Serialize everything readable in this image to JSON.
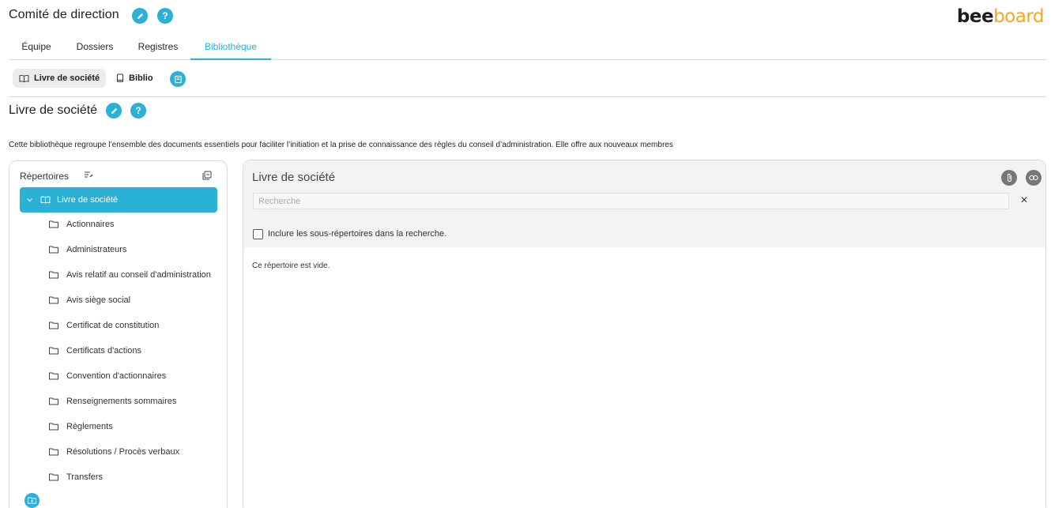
{
  "header": {
    "title": "Comité de direction",
    "edit_icon": "pencil-icon",
    "help_label": "?",
    "logo_part1": "bee",
    "logo_part2": "board"
  },
  "main_tabs": [
    {
      "label": "Équipe",
      "active": false
    },
    {
      "label": "Dossiers",
      "active": false
    },
    {
      "label": "Registres",
      "active": false
    },
    {
      "label": "Bibliothèque",
      "active": true
    }
  ],
  "sub_tabs": [
    {
      "label": "Livre de société",
      "icon": "open-book-icon",
      "active": true
    },
    {
      "label": "Biblio",
      "icon": "book-icon",
      "active": false
    }
  ],
  "section": {
    "title": "Livre de société",
    "help_label": "?",
    "description": "Cette bibliothèque regroupe l’ensemble des documents essentiels pour faciliter l’initiation et la prise de connaissance des règles du conseil d’administration. Elle offre aux nouveaux membres"
  },
  "tree": {
    "heading": "Répertoires",
    "root_label": "Livre de société",
    "items": [
      "Actionnaires",
      "Administrateurs",
      "Avis relatif au conseil d'administration",
      "Avis siège social",
      "Certificat de constitution",
      "Certificats d'actions",
      "Convention d'actionnaires",
      "Renseignements sommaires",
      "Règlements",
      "Résolutions / Procès verbaux",
      "Transfers"
    ]
  },
  "content": {
    "title": "Livre de société",
    "search_placeholder": "Recherche",
    "search_value": "",
    "clear_label": "×",
    "checkbox_label": "Inclure les sous-répertoires dans la recherche.",
    "empty_message": "Ce répertoire est vide."
  },
  "colors": {
    "accent": "#2bb0d6",
    "logo_orange": "#f5a623",
    "panel_grey": "#f3f3f4"
  }
}
